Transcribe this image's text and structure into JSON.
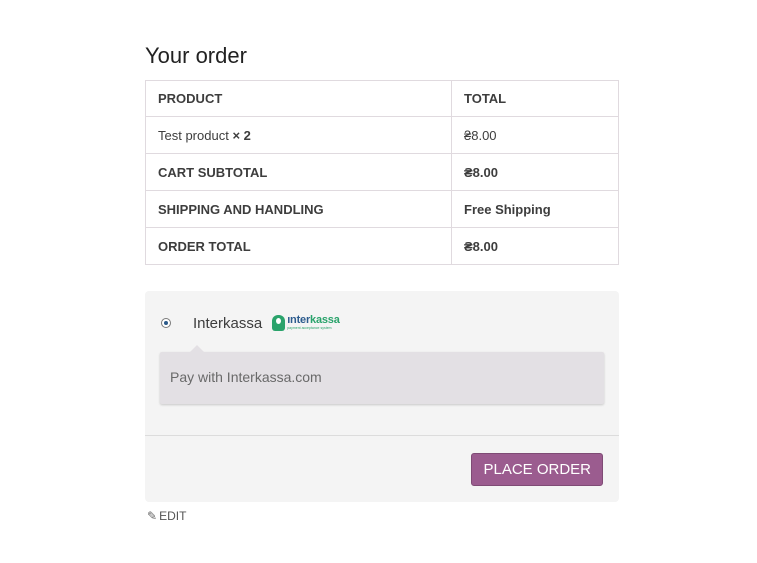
{
  "heading": "Your order",
  "table": {
    "header": {
      "product": "PRODUCT",
      "total": "TOTAL"
    },
    "item": {
      "name": "Test product",
      "qty": "× 2",
      "total": "₴8.00"
    },
    "subtotal": {
      "label": "CART SUBTOTAL",
      "value": "₴8.00"
    },
    "shipping": {
      "label": "SHIPPING AND HANDLING",
      "value": "Free Shipping"
    },
    "order_total": {
      "label": "ORDER TOTAL",
      "value": "₴8.00"
    }
  },
  "payment": {
    "method_label": "Interkassa",
    "logo_word_a": "ınter",
    "logo_word_b": "kassa",
    "logo_tagline": "payment acceptance system",
    "description": "Pay with Interkassa.com",
    "selected": true
  },
  "place_order_label": "PLACE ORDER",
  "edit_label": "EDIT",
  "colors": {
    "button": "#9b5c8f",
    "logo_green": "#2aa36b",
    "logo_blue": "#2c5b8e"
  }
}
